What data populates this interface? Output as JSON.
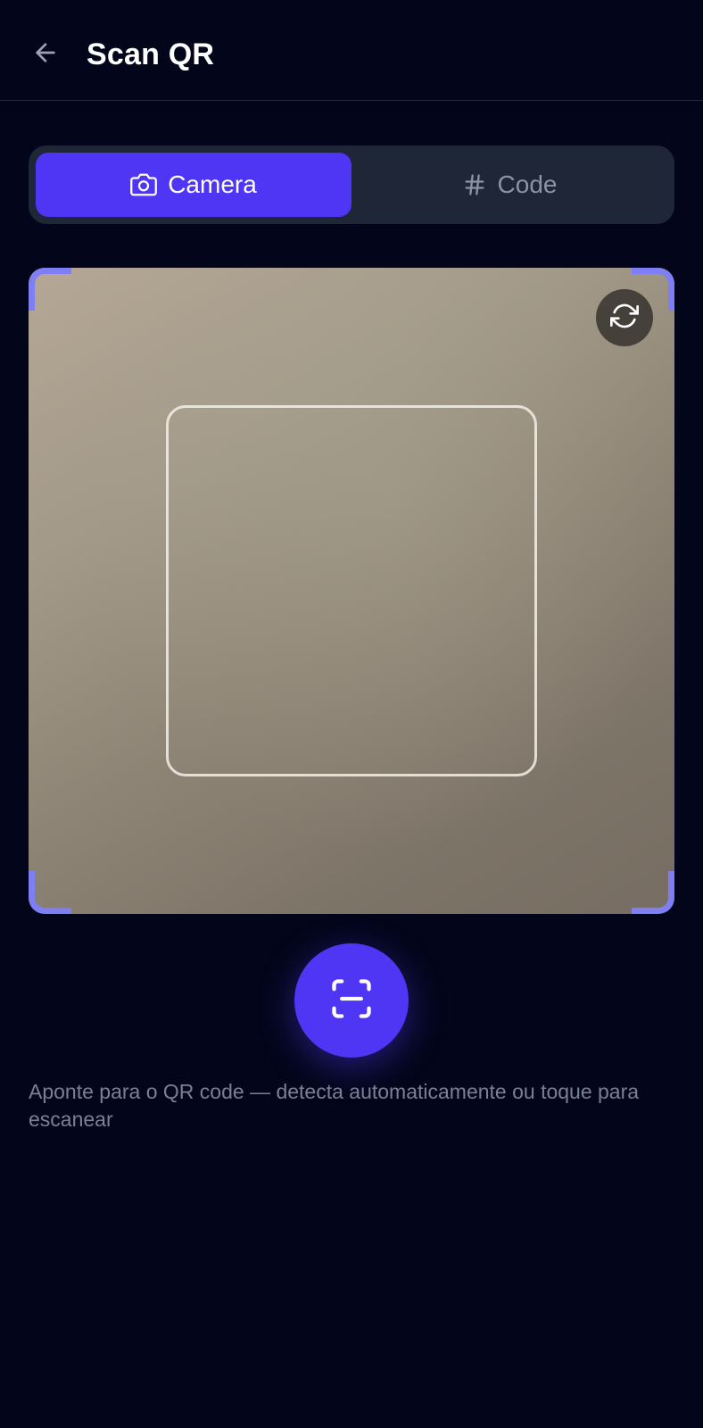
{
  "header": {
    "title": "Scan QR",
    "back_icon": "arrow-left-icon"
  },
  "tabs": [
    {
      "label": "Camera",
      "icon": "camera-icon",
      "active": true
    },
    {
      "label": "Code",
      "icon": "hash-icon",
      "active": false
    }
  ],
  "camera": {
    "flip_icon": "refresh-icon",
    "frame_color": "#7e7ef5"
  },
  "scan_button": {
    "icon": "scan-icon",
    "color": "#4f36f5"
  },
  "hint": "Aponte para o QR code — detecta automaticamente ou toque para escanear",
  "colors": {
    "background": "#03061a",
    "accent": "#4f36f5",
    "segment_bg": "#1e2638",
    "muted_text": "#7a8196"
  }
}
